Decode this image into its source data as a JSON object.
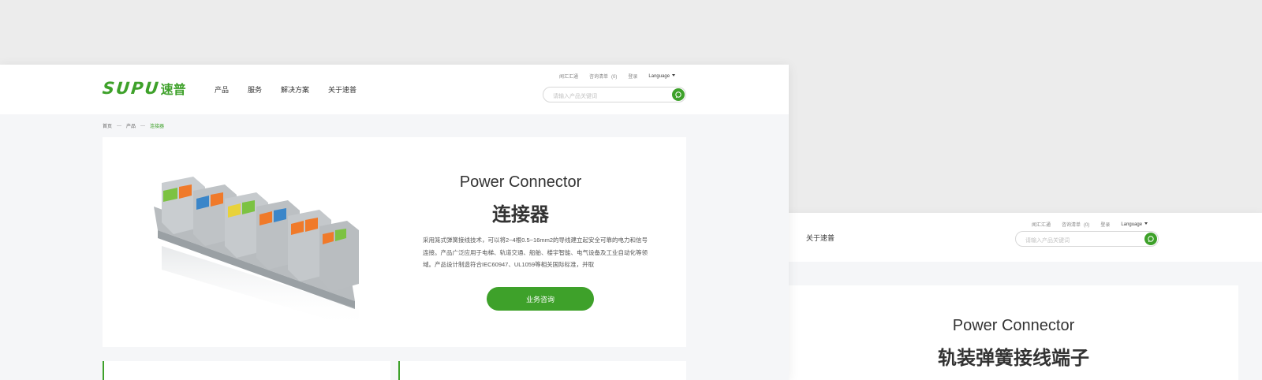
{
  "brand": {
    "logo_latin": "SUPU",
    "logo_cn": "速普",
    "accent": "#3ea12a"
  },
  "nav": [
    "产品",
    "服务",
    "解决方案",
    "关于速普"
  ],
  "utility": {
    "links": [
      "闻汇汇通",
      "咨询清单",
      "登录"
    ],
    "count": "(0)",
    "language": "Language"
  },
  "search": {
    "placeholder": "请输入产品关键词"
  },
  "breadcrumb": [
    "首页",
    "产品",
    "连接器"
  ],
  "product": {
    "title_en": "Power Connector",
    "title_cn": "连接器",
    "description": "采用笼式弹簧接线技术，可以将2~4根0.5~16mm2的导线建立起安全可靠的电力和信号连接。产品广泛应用于电梯、轨道交通、船舶、楼宇智能、电气设备及工业自动化等领域。产品设计制造符合IEC60947、UL1059等相关国际标准，并取",
    "consult_button": "业务咨询"
  },
  "back_window": {
    "nav_item": "关于速普",
    "utility_links": [
      "闻汇汇通",
      "咨询清单",
      "登录"
    ],
    "count": "(0)",
    "language": "Language",
    "search_placeholder": "请输入产品关键词",
    "title_en": "Power Connector",
    "title_cn": "轨装弹簧接线端子"
  }
}
